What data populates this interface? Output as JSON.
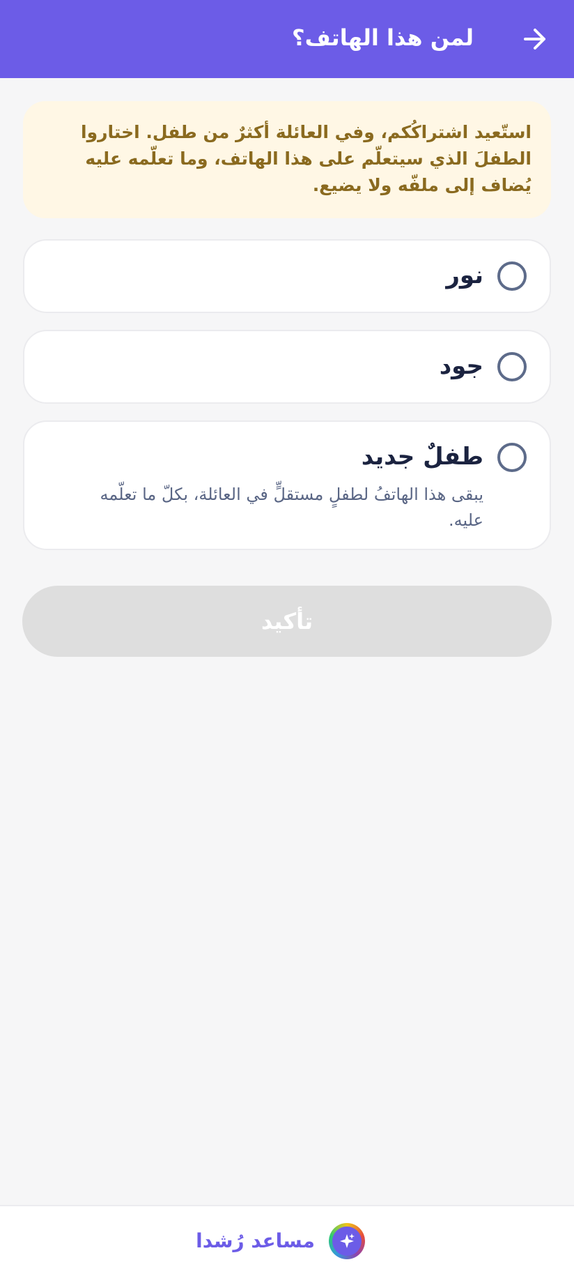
{
  "header": {
    "title": "لمن هذا الهاتف؟",
    "back_icon": "arrow-right-icon"
  },
  "notice": {
    "text": "استّعيد اشتراكُكم، وفي العائلة أكثرٌ من طفل. اختاروا الطفلَ الذي سيتعلّم على هذا الهاتف، وما تعلّمه عليه يُضاف إلى ملفّه ولا يضيع."
  },
  "options": [
    {
      "label": "نور",
      "description": "",
      "selected": false
    },
    {
      "label": "جود",
      "description": "",
      "selected": false
    },
    {
      "label": "طفلٌ جديد",
      "description": "يبقى هذا الهاتفُ لطفلٍ مستقلٍّ في العائلة، بكلّ ما تعلّمه عليه.",
      "selected": false
    }
  ],
  "confirm": {
    "label": "تأكيد",
    "enabled": false
  },
  "assistant": {
    "label": "مساعد رُشدا",
    "icon": "sparkles-icon"
  },
  "colors": {
    "primary": "#6c5ce7",
    "notice_bg": "#fff7e5",
    "notice_text": "#8a6a1f",
    "disabled_button": "#dedede"
  }
}
